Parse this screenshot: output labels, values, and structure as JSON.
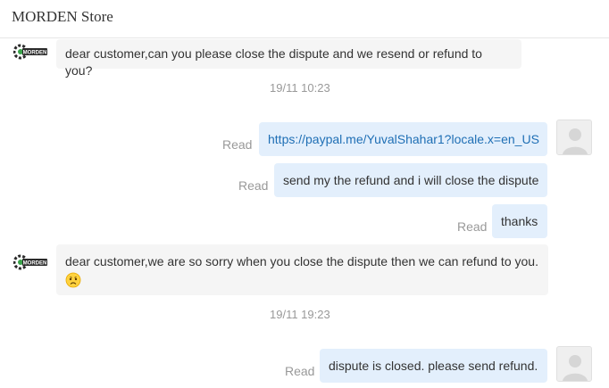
{
  "header": {
    "title": "MORDEN Store"
  },
  "store_logo": {
    "text": "MORDEN"
  },
  "messages": [
    {
      "text": "dear customer,can you please close the dispute and we resend or refund to you?"
    },
    {
      "text": "https://paypal.me/YuvalShahar1?locale.x=en_US",
      "status": "Read"
    },
    {
      "text": "send my the refund and i will close the dispute",
      "status": "Read"
    },
    {
      "text": "thanks",
      "status": "Read"
    },
    {
      "text": "dear customer,we are so sorry when you close the dispute then we can refund to you.",
      "emoji": "worried-face"
    },
    {
      "text": "dispute is closed. please send refund.",
      "status": "Read"
    }
  ],
  "timestamps": [
    "19/11 10:23",
    "19/11 19:23"
  ],
  "colors": {
    "incoming_bubble": "#f5f5f5",
    "outgoing_bubble": "#e3effc",
    "link": "#1f6fb5",
    "status_text": "#999999"
  }
}
